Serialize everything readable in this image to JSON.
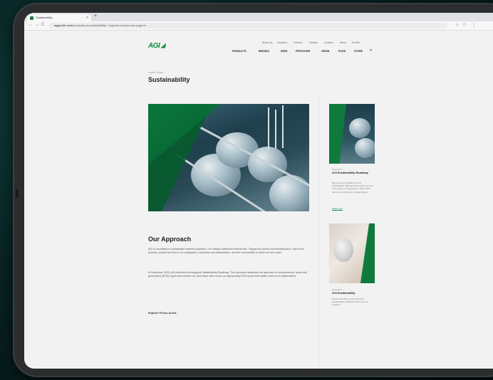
{
  "browser": {
    "tab_title": "Sustainability",
    "tab_close": "×",
    "new_tab": "+",
    "url_host": "aggrowth.com",
    "url_path": "/en-us/why-is-sustainability • /way-the-reason-new-page-id",
    "nav_back": "←",
    "nav_forward": "→",
    "nav_reload": "C",
    "icon_star": "☆",
    "icon_ext": "□",
    "icon_menu": "⋮"
  },
  "site": {
    "logo_text": "AGI",
    "utility_nav": [
      "About Us",
      "Investors",
      "Careers",
      "Dealers",
      "Contact",
      "News",
      "Events"
    ],
    "main_nav": [
      "PRODUCTS",
      "BRANDS",
      "SEED",
      "FERTILIZER",
      "GRAIN",
      "FOOD",
      "STORE"
    ],
    "search_icon": "⌕"
  },
  "page": {
    "breadcrumb": "Home / About",
    "title": "Sustainability",
    "approach_heading": "Our Approach",
    "approach_p1": "AGI is committed to sustainable business practices. Our mission statement reflects this: \"Supply the world's food infrastructure, add to the process, protect the food of our employees, customers and stakeholders, and the communities in which we are a part.\"",
    "approach_p2": "In December 2024, AGI published its inaugural Sustainability Roadmap. This document describes our approach to environmental, social and governance (ESG) topics and outlines our next steps with a focus on high-priority ESG issues that matter most to our stakeholders.",
    "explore_label": "Explore Focus Areas"
  },
  "sidebar": {
    "card1": {
      "label": "Resources",
      "title": "AGI Sustainability Roadmap",
      "text": "We're proud to publish our first sustainability roadmap that outlines our key focus areas, our approach to ESG topics and our commitments to stakeholders.",
      "link": "Read more"
    },
    "card2": {
      "label": "Resources",
      "title": "AGI Sustainability",
      "text": "Explore and learn more about the sustainability initiatives at AGI and our progress.",
      "link": ""
    }
  },
  "colors": {
    "brand_green": "#0e8a3e",
    "page_bg": "#f2f2f2",
    "tablet_frame": "#2b2d2f"
  }
}
